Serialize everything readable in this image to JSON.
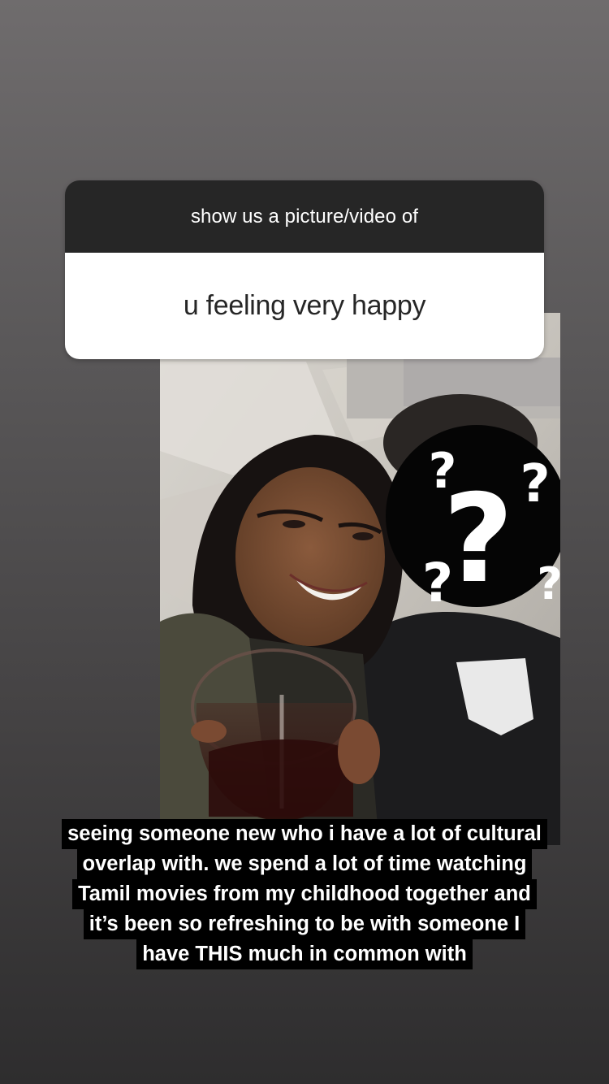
{
  "question_sticker": {
    "prompt": "show us a picture/video of",
    "answer": "u feeling very happy"
  },
  "photo": {
    "obscured_face_icon": "question-marks-icon"
  },
  "caption": {
    "lines": [
      "seeing someone new who i have a lot of cultural",
      "overlap with. we spend a lot of time watching",
      "Tamil movies from my childhood together and",
      "it’s been so refreshing to be with someone I",
      "have THIS much in common with"
    ]
  },
  "colors": {
    "sticker_header": "#262626",
    "sticker_body": "#ffffff",
    "caption_bg": "#000000",
    "caption_text": "#ffffff"
  }
}
